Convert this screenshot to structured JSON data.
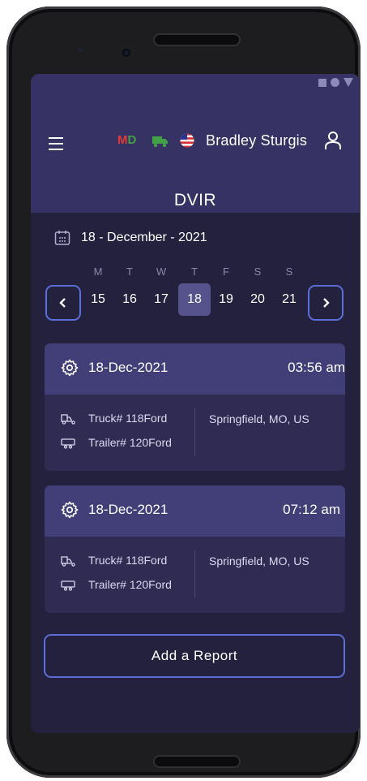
{
  "header": {
    "badge_m": "M",
    "badge_d": "D",
    "user_name": "Bradley Sturgis",
    "title": "DVIR"
  },
  "calendar": {
    "date_label": "18 - December - 2021",
    "days": [
      {
        "dow": "M",
        "num": "15"
      },
      {
        "dow": "T",
        "num": "16"
      },
      {
        "dow": "W",
        "num": "17"
      },
      {
        "dow": "T",
        "num": "18"
      },
      {
        "dow": "F",
        "num": "19"
      },
      {
        "dow": "S",
        "num": "20"
      },
      {
        "dow": "S",
        "num": "21"
      }
    ],
    "selected": "18"
  },
  "reports": [
    {
      "date": "18-Dec-2021",
      "time": "03:56 am",
      "truck": "Truck# 118Ford",
      "trailer": "Trailer# 120Ford",
      "location": "Springfield, MO, US"
    },
    {
      "date": "18-Dec-2021",
      "time": "07:12 am",
      "truck": "Truck# 118Ford",
      "trailer": "Trailer# 120Ford",
      "location": "Springfield, MO, US"
    }
  ],
  "actions": {
    "add_report": "Add a Report"
  },
  "colors": {
    "background": "#24213f",
    "header": "#363263",
    "card": "#2f2b52",
    "card_head": "#423e78",
    "accent": "#5a6fd6",
    "selected_day": "#55528c"
  },
  "icons": [
    "menu-icon",
    "truck-icon",
    "us-flag-icon",
    "user-icon",
    "calendar-icon",
    "chevron-left-icon",
    "chevron-right-icon",
    "gear-icon",
    "trailer-icon"
  ]
}
